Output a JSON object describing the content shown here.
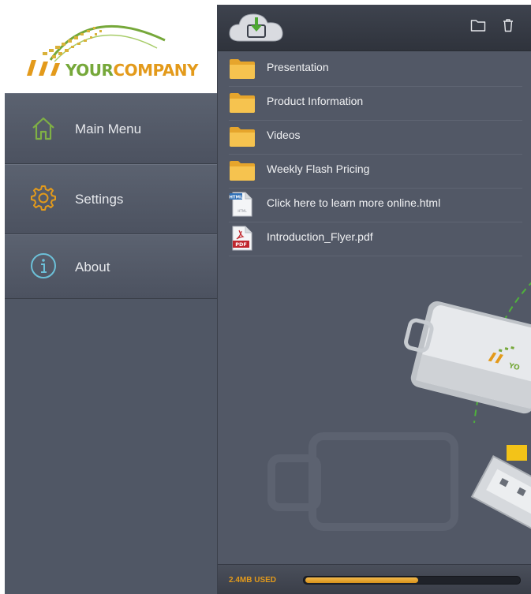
{
  "brand": {
    "word1": "YOUR",
    "word2": "COMPANY"
  },
  "sidebar": {
    "items": [
      {
        "label": "Main Menu",
        "icon": "home-icon"
      },
      {
        "label": "Settings",
        "icon": "gear-icon"
      },
      {
        "label": "About",
        "icon": "info-icon"
      }
    ]
  },
  "toolbar": {
    "icons": [
      "cloud-download-icon",
      "folder-icon",
      "trash-icon"
    ]
  },
  "files": [
    {
      "name": "Presentation",
      "type": "folder"
    },
    {
      "name": "Product Information",
      "type": "folder"
    },
    {
      "name": "Videos",
      "type": "folder"
    },
    {
      "name": "Weekly Flash Pricing",
      "type": "folder"
    },
    {
      "name": "Click here to learn more online.html",
      "type": "html",
      "badge": "HTML"
    },
    {
      "name": "Introduction_Flyer.pdf",
      "type": "pdf",
      "badge": "PDF"
    }
  ],
  "storage": {
    "used_label": "2.4MB USED",
    "fraction": 0.53
  },
  "colors": {
    "accent": "#e39a1b",
    "green": "#76a83a",
    "panel": "#525866"
  }
}
